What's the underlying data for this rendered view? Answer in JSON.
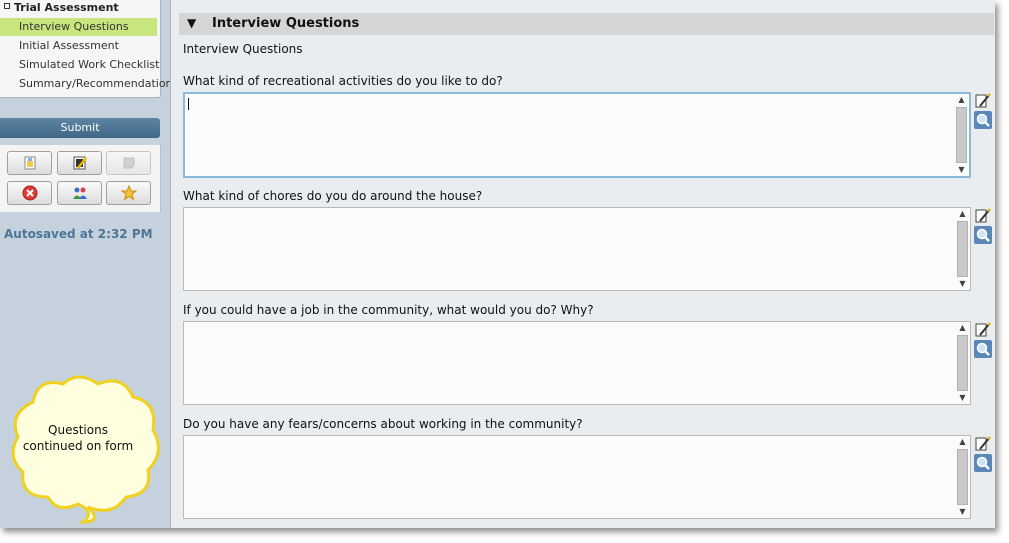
{
  "sidebar": {
    "section_title": "Trial Assessment",
    "items": [
      {
        "label": "Interview Questions",
        "active": true
      },
      {
        "label": "Initial Assessment",
        "active": false
      },
      {
        "label": "Simulated Work Checklist",
        "active": false
      },
      {
        "label": "Summary/Recommendations",
        "active": false
      }
    ],
    "submit_label": "Submit",
    "toolbox_icons": [
      "new-document-icon",
      "edit-document-icon",
      "note-icon",
      "delete-icon",
      "users-icon",
      "favorite-star-icon"
    ],
    "autosave_text": "Autosaved at 2:32 PM",
    "callout_text_line1": "Questions",
    "callout_text_line2": "continued on form"
  },
  "main": {
    "section_title": "Interview Questions",
    "subheading": "Interview Questions",
    "questions": [
      {
        "label": "What kind of recreational activities do you like to do?",
        "value": ""
      },
      {
        "label": "What kind of chores do you do around the house?",
        "value": ""
      },
      {
        "label": "If you could have a job in the community, what would you do? Why?",
        "value": ""
      },
      {
        "label": "Do you have any fears/concerns about working in the community?",
        "value": ""
      }
    ],
    "field_icons": [
      "spell-check-icon",
      "zoom-icon"
    ]
  },
  "colors": {
    "active_nav": "#c7e67e",
    "submit_button": "#4a7393",
    "autosave_text": "#4d7597",
    "focus_border": "#8ab9dc"
  }
}
